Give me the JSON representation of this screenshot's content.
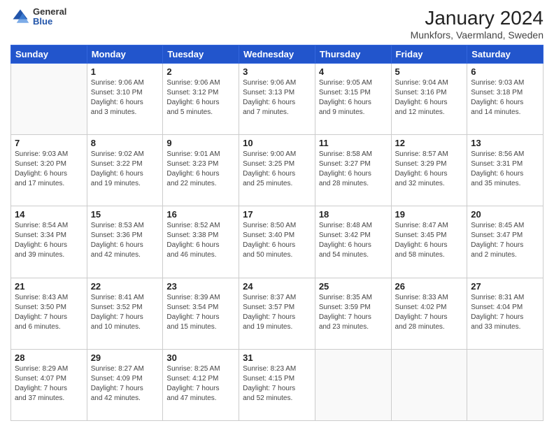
{
  "header": {
    "title": "January 2024",
    "subtitle": "Munkfors, Vaermland, Sweden",
    "logo_general": "General",
    "logo_blue": "Blue"
  },
  "weekdays": [
    "Sunday",
    "Monday",
    "Tuesday",
    "Wednesday",
    "Thursday",
    "Friday",
    "Saturday"
  ],
  "weeks": [
    [
      {
        "day": "",
        "info": ""
      },
      {
        "day": "1",
        "info": "Sunrise: 9:06 AM\nSunset: 3:10 PM\nDaylight: 6 hours\nand 3 minutes."
      },
      {
        "day": "2",
        "info": "Sunrise: 9:06 AM\nSunset: 3:12 PM\nDaylight: 6 hours\nand 5 minutes."
      },
      {
        "day": "3",
        "info": "Sunrise: 9:06 AM\nSunset: 3:13 PM\nDaylight: 6 hours\nand 7 minutes."
      },
      {
        "day": "4",
        "info": "Sunrise: 9:05 AM\nSunset: 3:15 PM\nDaylight: 6 hours\nand 9 minutes."
      },
      {
        "day": "5",
        "info": "Sunrise: 9:04 AM\nSunset: 3:16 PM\nDaylight: 6 hours\nand 12 minutes."
      },
      {
        "day": "6",
        "info": "Sunrise: 9:03 AM\nSunset: 3:18 PM\nDaylight: 6 hours\nand 14 minutes."
      }
    ],
    [
      {
        "day": "7",
        "info": "Sunrise: 9:03 AM\nSunset: 3:20 PM\nDaylight: 6 hours\nand 17 minutes."
      },
      {
        "day": "8",
        "info": "Sunrise: 9:02 AM\nSunset: 3:22 PM\nDaylight: 6 hours\nand 19 minutes."
      },
      {
        "day": "9",
        "info": "Sunrise: 9:01 AM\nSunset: 3:23 PM\nDaylight: 6 hours\nand 22 minutes."
      },
      {
        "day": "10",
        "info": "Sunrise: 9:00 AM\nSunset: 3:25 PM\nDaylight: 6 hours\nand 25 minutes."
      },
      {
        "day": "11",
        "info": "Sunrise: 8:58 AM\nSunset: 3:27 PM\nDaylight: 6 hours\nand 28 minutes."
      },
      {
        "day": "12",
        "info": "Sunrise: 8:57 AM\nSunset: 3:29 PM\nDaylight: 6 hours\nand 32 minutes."
      },
      {
        "day": "13",
        "info": "Sunrise: 8:56 AM\nSunset: 3:31 PM\nDaylight: 6 hours\nand 35 minutes."
      }
    ],
    [
      {
        "day": "14",
        "info": "Sunrise: 8:54 AM\nSunset: 3:34 PM\nDaylight: 6 hours\nand 39 minutes."
      },
      {
        "day": "15",
        "info": "Sunrise: 8:53 AM\nSunset: 3:36 PM\nDaylight: 6 hours\nand 42 minutes."
      },
      {
        "day": "16",
        "info": "Sunrise: 8:52 AM\nSunset: 3:38 PM\nDaylight: 6 hours\nand 46 minutes."
      },
      {
        "day": "17",
        "info": "Sunrise: 8:50 AM\nSunset: 3:40 PM\nDaylight: 6 hours\nand 50 minutes."
      },
      {
        "day": "18",
        "info": "Sunrise: 8:48 AM\nSunset: 3:42 PM\nDaylight: 6 hours\nand 54 minutes."
      },
      {
        "day": "19",
        "info": "Sunrise: 8:47 AM\nSunset: 3:45 PM\nDaylight: 6 hours\nand 58 minutes."
      },
      {
        "day": "20",
        "info": "Sunrise: 8:45 AM\nSunset: 3:47 PM\nDaylight: 7 hours\nand 2 minutes."
      }
    ],
    [
      {
        "day": "21",
        "info": "Sunrise: 8:43 AM\nSunset: 3:50 PM\nDaylight: 7 hours\nand 6 minutes."
      },
      {
        "day": "22",
        "info": "Sunrise: 8:41 AM\nSunset: 3:52 PM\nDaylight: 7 hours\nand 10 minutes."
      },
      {
        "day": "23",
        "info": "Sunrise: 8:39 AM\nSunset: 3:54 PM\nDaylight: 7 hours\nand 15 minutes."
      },
      {
        "day": "24",
        "info": "Sunrise: 8:37 AM\nSunset: 3:57 PM\nDaylight: 7 hours\nand 19 minutes."
      },
      {
        "day": "25",
        "info": "Sunrise: 8:35 AM\nSunset: 3:59 PM\nDaylight: 7 hours\nand 23 minutes."
      },
      {
        "day": "26",
        "info": "Sunrise: 8:33 AM\nSunset: 4:02 PM\nDaylight: 7 hours\nand 28 minutes."
      },
      {
        "day": "27",
        "info": "Sunrise: 8:31 AM\nSunset: 4:04 PM\nDaylight: 7 hours\nand 33 minutes."
      }
    ],
    [
      {
        "day": "28",
        "info": "Sunrise: 8:29 AM\nSunset: 4:07 PM\nDaylight: 7 hours\nand 37 minutes."
      },
      {
        "day": "29",
        "info": "Sunrise: 8:27 AM\nSunset: 4:09 PM\nDaylight: 7 hours\nand 42 minutes."
      },
      {
        "day": "30",
        "info": "Sunrise: 8:25 AM\nSunset: 4:12 PM\nDaylight: 7 hours\nand 47 minutes."
      },
      {
        "day": "31",
        "info": "Sunrise: 8:23 AM\nSunset: 4:15 PM\nDaylight: 7 hours\nand 52 minutes."
      },
      {
        "day": "",
        "info": ""
      },
      {
        "day": "",
        "info": ""
      },
      {
        "day": "",
        "info": ""
      }
    ]
  ]
}
